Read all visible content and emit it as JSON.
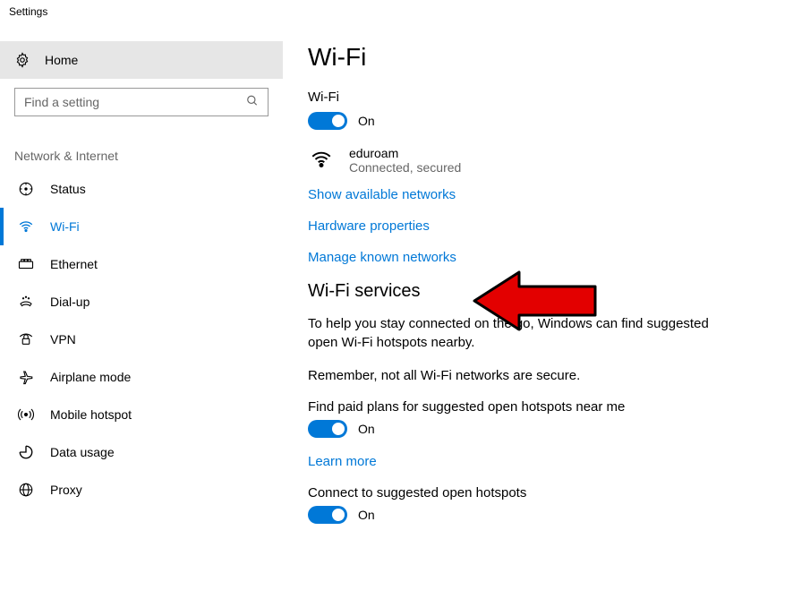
{
  "window_title": "Settings",
  "sidebar": {
    "home": "Home",
    "search_placeholder": "Find a setting",
    "category": "Network & Internet",
    "items": [
      {
        "label": "Status"
      },
      {
        "label": "Wi-Fi"
      },
      {
        "label": "Ethernet"
      },
      {
        "label": "Dial-up"
      },
      {
        "label": "VPN"
      },
      {
        "label": "Airplane mode"
      },
      {
        "label": "Mobile hotspot"
      },
      {
        "label": "Data usage"
      },
      {
        "label": "Proxy"
      }
    ]
  },
  "main": {
    "title": "Wi-Fi",
    "wifi_section_label": "Wi-Fi",
    "wifi_toggle_state": "On",
    "ssid": "eduroam",
    "ssid_status": "Connected, secured",
    "link_show_networks": "Show available networks",
    "link_hw_properties": "Hardware properties",
    "link_manage_known": "Manage known networks",
    "services_heading": "Wi-Fi services",
    "services_desc": "To help you stay connected on the go, Windows can find suggested open Wi-Fi hotspots nearby.",
    "services_warning": "Remember, not all Wi-Fi networks are secure.",
    "paid_plans_label": "Find paid plans for suggested open hotspots near me",
    "paid_plans_toggle": "On",
    "learn_more": "Learn more",
    "connect_suggested_label": "Connect to suggested open hotspots",
    "connect_suggested_toggle": "On"
  }
}
